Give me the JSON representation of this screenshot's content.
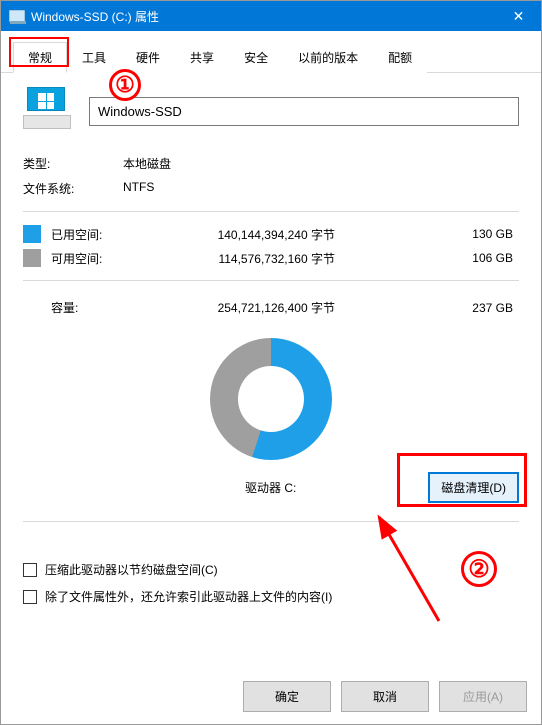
{
  "titlebar": {
    "title": "Windows-SSD (C:) 属性"
  },
  "tabs": [
    {
      "label": "常规",
      "active": true
    },
    {
      "label": "工具"
    },
    {
      "label": "硬件"
    },
    {
      "label": "共享"
    },
    {
      "label": "安全"
    },
    {
      "label": "以前的版本"
    },
    {
      "label": "配额"
    }
  ],
  "drive_name_value": "Windows-SSD",
  "type_row": {
    "label": "类型:",
    "value": "本地磁盘"
  },
  "fs_row": {
    "label": "文件系统:",
    "value": "NTFS"
  },
  "used": {
    "label": "已用空间:",
    "bytes": "140,144,394,240 字节",
    "human": "130 GB"
  },
  "free": {
    "label": "可用空间:",
    "bytes": "114,576,732,160 字节",
    "human": "106 GB"
  },
  "capacity": {
    "label": "容量:",
    "bytes": "254,721,126,400 字节",
    "human": "237 GB"
  },
  "drive_label": "驱动器 C:",
  "cleanup_button": "磁盘清理(D)",
  "compress_check": "压缩此驱动器以节约磁盘空间(C)",
  "index_check": "除了文件属性外，还允许索引此驱动器上文件的内容(I)",
  "buttons": {
    "ok": "确定",
    "cancel": "取消",
    "apply": "应用(A)"
  },
  "callouts": {
    "one": "①",
    "two": "②"
  },
  "chart_data": {
    "type": "pie",
    "title": "驱动器 C:",
    "series": [
      {
        "name": "已用空间",
        "value": 130,
        "color": "#1e9fe8"
      },
      {
        "name": "可用空间",
        "value": 106,
        "color": "#9f9f9f"
      }
    ],
    "unit": "GB",
    "total": 237
  }
}
